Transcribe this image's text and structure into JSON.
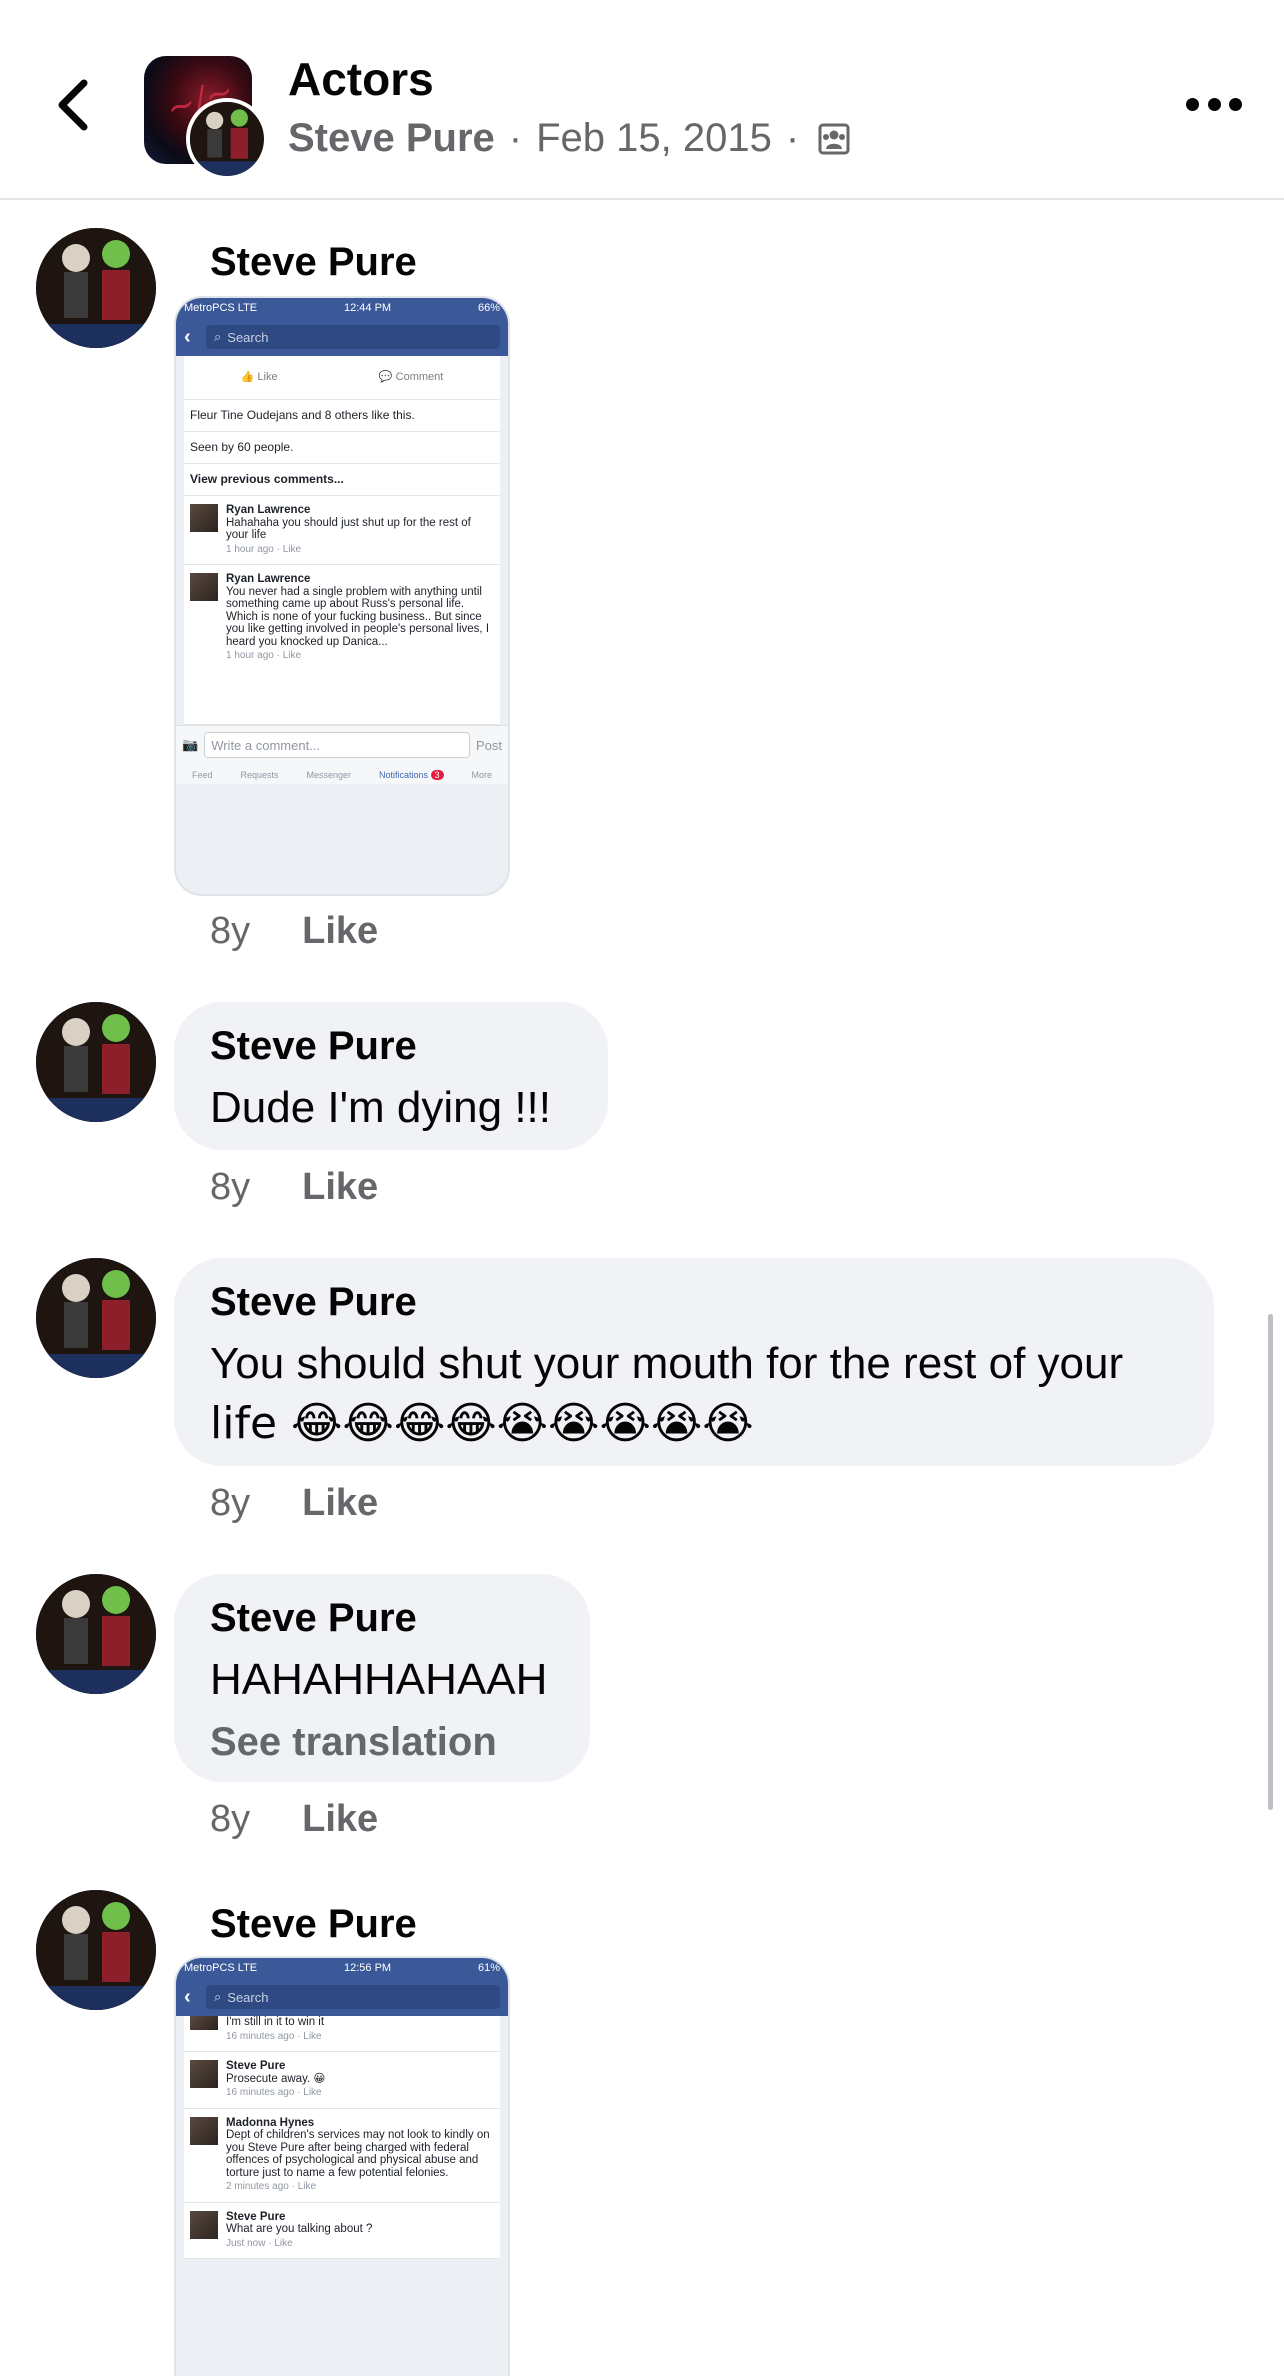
{
  "header": {
    "title": "Actors",
    "author": "Steve Pure",
    "separator": "·",
    "date": "Feb 15, 2015",
    "back_icon": "chevron-left-icon",
    "audience_icon": "group-audience-icon",
    "more_icon": "more-horizontal-icon"
  },
  "comments": [
    {
      "name": "Steve Pure",
      "time": "8y",
      "like_label": "Like",
      "attachment": {
        "status_left": "MetroPCS  LTE",
        "status_time": "12:44 PM",
        "status_battery": "66%",
        "search_placeholder": "Search",
        "like_label": "Like",
        "comment_label": "Comment",
        "likes_line": "Fleur Tine Oudejans and 8 others like this.",
        "seen_line": "Seen by 60 people.",
        "previous_comments": "View previous comments...",
        "items": [
          {
            "who": "Ryan Lawrence",
            "text": "Hahahaha you should just shut up for the rest of your life",
            "when": "1 hour ago · Like"
          },
          {
            "who": "Ryan Lawrence",
            "text": "You never had a single problem with anything until something came up about Russ's personal life. Which is none of your fucking business.. But since you like getting involved in people's personal lives, I heard you knocked up Danica...",
            "when": "1 hour ago · Like"
          }
        ],
        "compose_placeholder": "Write a comment...",
        "post_label": "Post",
        "tabs": [
          "Feed",
          "Requests",
          "Messenger",
          "Notifications",
          "More"
        ],
        "notifications_badge": "3"
      }
    },
    {
      "name": "Steve Pure",
      "text": "Dude I'm dying !!!",
      "time": "8y",
      "like_label": "Like"
    },
    {
      "name": "Steve Pure",
      "text_line1": "You should shut your mouth for the rest of your",
      "text_line2": "life 😂😂😂😂😭😭😭😭😭",
      "time": "8y",
      "like_label": "Like"
    },
    {
      "name": "Steve Pure",
      "text": "HAHAHHAHAAH",
      "see_translation": "See translation",
      "time": "8y",
      "like_label": "Like"
    },
    {
      "name": "Steve Pure",
      "attachment": {
        "status_left": "MetroPCS  LTE",
        "status_time": "12:56 PM",
        "status_battery": "61%",
        "search_placeholder": "Search",
        "items": [
          {
            "who": "",
            "text": "I'm still in it to win it",
            "when": "16 minutes ago · Like"
          },
          {
            "who": "Steve Pure",
            "text": "Prosecute away. 😀",
            "when": "16 minutes ago · Like"
          },
          {
            "who": "Madonna Hynes",
            "text": "Dept of children's services may not look to kindly on you Steve Pure after being charged with federal offences of psychological and physical abuse and torture just to name a few potential felonies.",
            "when": "2 minutes ago · Like"
          },
          {
            "who": "Steve Pure",
            "text": "What are you talking about ?",
            "when": "Just now · Like"
          }
        ]
      }
    }
  ],
  "colors": {
    "bubble": "#f0f2f5",
    "secondary_text": "#65676b",
    "fb_blue": "#3b5998"
  }
}
